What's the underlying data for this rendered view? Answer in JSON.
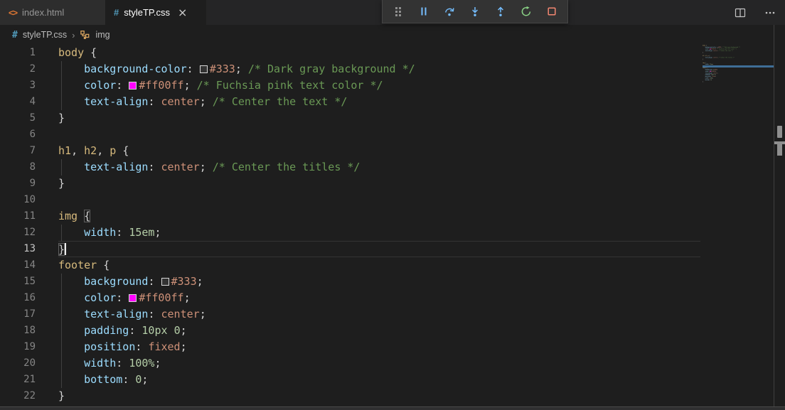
{
  "colors": {
    "editor_bg": "#1e1e1e",
    "tabbar_bg": "#252526",
    "inactive_tab_bg": "#2d2d2d",
    "active_tab_bg": "#1e1e1e",
    "toolbar_bg": "#333333",
    "selector": "#d7ba7d",
    "property": "#9cdcfe",
    "punctuation": "#d4d4d4",
    "value": "#ce9178",
    "number": "#b5cea8",
    "comment": "#6a9955",
    "line_number": "#858585",
    "current_line_number": "#c6c6c6",
    "html_icon": "#e37933",
    "css_icon": "#519aba",
    "debug_blue": "#75beff",
    "restart_green": "#89d185",
    "stop_red": "#f48771",
    "minimap_highlight": "#3f6e96"
  },
  "tabs": [
    {
      "label": "index.html",
      "icon_glyph": "<>",
      "active": false
    },
    {
      "label": "styleTP.css",
      "icon_glyph": "#",
      "active": true,
      "close_glyph": "×"
    }
  ],
  "tab_actions": {
    "split_editor": "split-editor-icon",
    "more_actions": "ellipsis-icon"
  },
  "breadcrumb": {
    "file_icon_glyph": "#",
    "file": "styleTP.css",
    "separator": "›",
    "symbol": "img"
  },
  "debug_toolbar": {
    "buttons": [
      "drag-handle",
      "pause",
      "step-over",
      "step-into",
      "step-out",
      "restart",
      "stop"
    ]
  },
  "editor": {
    "current_line": 13,
    "lines": [
      {
        "num": 1,
        "tokens": [
          {
            "t": "body",
            "c": "sel"
          },
          {
            "t": " ",
            "c": "plain"
          },
          {
            "t": "{",
            "c": "punc"
          }
        ]
      },
      {
        "num": 2,
        "g": true,
        "tokens": [
          {
            "t": "    ",
            "c": "plain"
          },
          {
            "t": "background-color",
            "c": "prop"
          },
          {
            "t": ":",
            "c": "punc"
          },
          {
            "t": " ",
            "c": "plain"
          },
          {
            "swatch": "#333333"
          },
          {
            "t": "#333",
            "c": "val"
          },
          {
            "t": ";",
            "c": "punc"
          },
          {
            "t": " ",
            "c": "plain"
          },
          {
            "t": "/* Dark gray background */",
            "c": "com"
          }
        ]
      },
      {
        "num": 3,
        "g": true,
        "tokens": [
          {
            "t": "    ",
            "c": "plain"
          },
          {
            "t": "color",
            "c": "prop"
          },
          {
            "t": ":",
            "c": "punc"
          },
          {
            "t": " ",
            "c": "plain"
          },
          {
            "swatch": "#ff00ff"
          },
          {
            "t": "#ff00ff",
            "c": "val"
          },
          {
            "t": ";",
            "c": "punc"
          },
          {
            "t": " ",
            "c": "plain"
          },
          {
            "t": "/* Fuchsia pink text color */",
            "c": "com"
          }
        ]
      },
      {
        "num": 4,
        "g": true,
        "tokens": [
          {
            "t": "    ",
            "c": "plain"
          },
          {
            "t": "text-align",
            "c": "prop"
          },
          {
            "t": ":",
            "c": "punc"
          },
          {
            "t": " ",
            "c": "plain"
          },
          {
            "t": "center",
            "c": "val"
          },
          {
            "t": ";",
            "c": "punc"
          },
          {
            "t": " ",
            "c": "plain"
          },
          {
            "t": "/* Center the text */",
            "c": "com"
          }
        ]
      },
      {
        "num": 5,
        "tokens": [
          {
            "t": "}",
            "c": "punc"
          }
        ]
      },
      {
        "num": 6,
        "tokens": []
      },
      {
        "num": 7,
        "tokens": [
          {
            "t": "h1",
            "c": "sel"
          },
          {
            "t": ", ",
            "c": "punc"
          },
          {
            "t": "h2",
            "c": "sel"
          },
          {
            "t": ", ",
            "c": "punc"
          },
          {
            "t": "p",
            "c": "sel"
          },
          {
            "t": " ",
            "c": "plain"
          },
          {
            "t": "{",
            "c": "punc"
          }
        ]
      },
      {
        "num": 8,
        "g": true,
        "tokens": [
          {
            "t": "    ",
            "c": "plain"
          },
          {
            "t": "text-align",
            "c": "prop"
          },
          {
            "t": ":",
            "c": "punc"
          },
          {
            "t": " ",
            "c": "plain"
          },
          {
            "t": "center",
            "c": "val"
          },
          {
            "t": ";",
            "c": "punc"
          },
          {
            "t": " ",
            "c": "plain"
          },
          {
            "t": "/* Center the titles */",
            "c": "com"
          }
        ]
      },
      {
        "num": 9,
        "tokens": [
          {
            "t": "}",
            "c": "punc"
          }
        ]
      },
      {
        "num": 10,
        "tokens": []
      },
      {
        "num": 11,
        "tokens": [
          {
            "t": "img",
            "c": "sel"
          },
          {
            "t": " ",
            "c": "plain"
          },
          {
            "t": "{",
            "c": "punc",
            "box": true
          }
        ]
      },
      {
        "num": 12,
        "g": true,
        "tokens": [
          {
            "t": "    ",
            "c": "plain"
          },
          {
            "t": "width",
            "c": "prop"
          },
          {
            "t": ":",
            "c": "punc"
          },
          {
            "t": " ",
            "c": "plain"
          },
          {
            "t": "15em",
            "c": "num"
          },
          {
            "t": ";",
            "c": "punc"
          }
        ]
      },
      {
        "num": 13,
        "cur": true,
        "cursor": true,
        "tokens": [
          {
            "t": "}",
            "c": "punc",
            "box": true
          }
        ]
      },
      {
        "num": 14,
        "tokens": [
          {
            "t": "footer",
            "c": "sel"
          },
          {
            "t": " ",
            "c": "plain"
          },
          {
            "t": "{",
            "c": "punc"
          }
        ]
      },
      {
        "num": 15,
        "g": true,
        "tokens": [
          {
            "t": "    ",
            "c": "plain"
          },
          {
            "t": "background",
            "c": "prop"
          },
          {
            "t": ":",
            "c": "punc"
          },
          {
            "t": " ",
            "c": "plain"
          },
          {
            "swatch": "#333333"
          },
          {
            "t": "#333",
            "c": "val"
          },
          {
            "t": ";",
            "c": "punc"
          }
        ]
      },
      {
        "num": 16,
        "g": true,
        "tokens": [
          {
            "t": "    ",
            "c": "plain"
          },
          {
            "t": "color",
            "c": "prop"
          },
          {
            "t": ":",
            "c": "punc"
          },
          {
            "t": " ",
            "c": "plain"
          },
          {
            "swatch": "#ff00ff"
          },
          {
            "t": "#ff00ff",
            "c": "val"
          },
          {
            "t": ";",
            "c": "punc"
          }
        ]
      },
      {
        "num": 17,
        "g": true,
        "tokens": [
          {
            "t": "    ",
            "c": "plain"
          },
          {
            "t": "text-align",
            "c": "prop"
          },
          {
            "t": ":",
            "c": "punc"
          },
          {
            "t": " ",
            "c": "plain"
          },
          {
            "t": "center",
            "c": "val"
          },
          {
            "t": ";",
            "c": "punc"
          }
        ]
      },
      {
        "num": 18,
        "g": true,
        "tokens": [
          {
            "t": "    ",
            "c": "plain"
          },
          {
            "t": "padding",
            "c": "prop"
          },
          {
            "t": ":",
            "c": "punc"
          },
          {
            "t": " ",
            "c": "plain"
          },
          {
            "t": "10px",
            "c": "num"
          },
          {
            "t": " ",
            "c": "plain"
          },
          {
            "t": "0",
            "c": "num"
          },
          {
            "t": ";",
            "c": "punc"
          }
        ]
      },
      {
        "num": 19,
        "g": true,
        "tokens": [
          {
            "t": "    ",
            "c": "plain"
          },
          {
            "t": "position",
            "c": "prop"
          },
          {
            "t": ":",
            "c": "punc"
          },
          {
            "t": " ",
            "c": "plain"
          },
          {
            "t": "fixed",
            "c": "val"
          },
          {
            "t": ";",
            "c": "punc"
          }
        ]
      },
      {
        "num": 20,
        "g": true,
        "tokens": [
          {
            "t": "    ",
            "c": "plain"
          },
          {
            "t": "width",
            "c": "prop"
          },
          {
            "t": ":",
            "c": "punc"
          },
          {
            "t": " ",
            "c": "plain"
          },
          {
            "t": "100%",
            "c": "num"
          },
          {
            "t": ";",
            "c": "punc"
          }
        ]
      },
      {
        "num": 21,
        "g": true,
        "tokens": [
          {
            "t": "    ",
            "c": "plain"
          },
          {
            "t": "bottom",
            "c": "prop"
          },
          {
            "t": ":",
            "c": "punc"
          },
          {
            "t": " ",
            "c": "plain"
          },
          {
            "t": "0",
            "c": "num"
          },
          {
            "t": ";",
            "c": "punc"
          }
        ]
      },
      {
        "num": 22,
        "tokens": [
          {
            "t": "}",
            "c": "punc"
          }
        ]
      }
    ]
  }
}
